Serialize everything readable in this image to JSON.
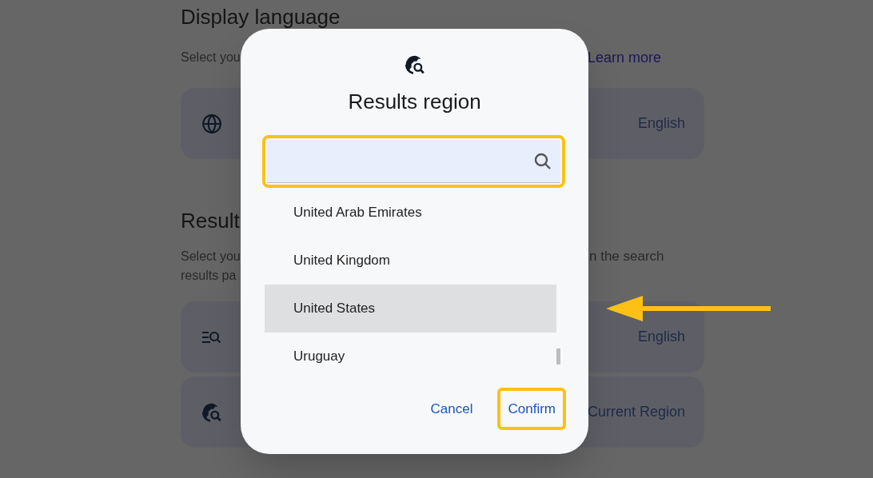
{
  "settings": {
    "sections": [
      {
        "heading": "Display language",
        "lines": [
          {
            "left": "Select you",
            "right": "Learn more",
            "kind": "link"
          }
        ],
        "cards": [
          {
            "value": "English"
          }
        ]
      },
      {
        "heading": "Result",
        "lines": [
          {
            "left": "Select you",
            "right": "n the search",
            "kind": "text"
          },
          {
            "left": "results pa"
          }
        ],
        "cards": [
          {
            "value": "English"
          },
          {
            "value": "Current Region"
          }
        ]
      }
    ]
  },
  "dialog": {
    "title": "Results region",
    "search": {
      "highlighted": true
    },
    "options": [
      {
        "label": "United Arab Emirates",
        "selected": false
      },
      {
        "label": "United Kingdom",
        "selected": false
      },
      {
        "label": "United States",
        "selected": true
      },
      {
        "label": "Uruguay",
        "selected": false
      }
    ],
    "buttons": [
      {
        "label": "Cancel",
        "highlighted": false
      },
      {
        "label": "Confirm",
        "highlighted": true
      }
    ]
  }
}
